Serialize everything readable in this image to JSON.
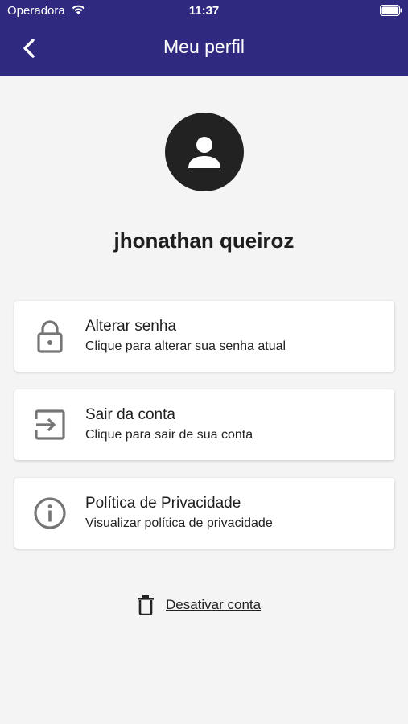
{
  "status_bar": {
    "carrier": "Operadora",
    "time": "11:37",
    "wifi_icon": "wifi-icon",
    "battery_icon": "battery-icon"
  },
  "header": {
    "title": "Meu perfil",
    "back_icon": "chevron-left-icon",
    "background_color": "#2f2a80"
  },
  "profile": {
    "avatar_icon": "person-icon",
    "name": "jhonathan queiroz"
  },
  "options": [
    {
      "icon": "lock-icon",
      "title": "Alterar senha",
      "subtitle": "Clique para alterar sua senha atual"
    },
    {
      "icon": "logout-icon",
      "title": "Sair da conta",
      "subtitle": "Clique para sair de sua conta"
    },
    {
      "icon": "info-icon",
      "title": "Política de Privacidade",
      "subtitle": "Visualizar política de privacidade"
    }
  ],
  "deactivate": {
    "icon": "trash-icon",
    "label": "Desativar conta"
  }
}
